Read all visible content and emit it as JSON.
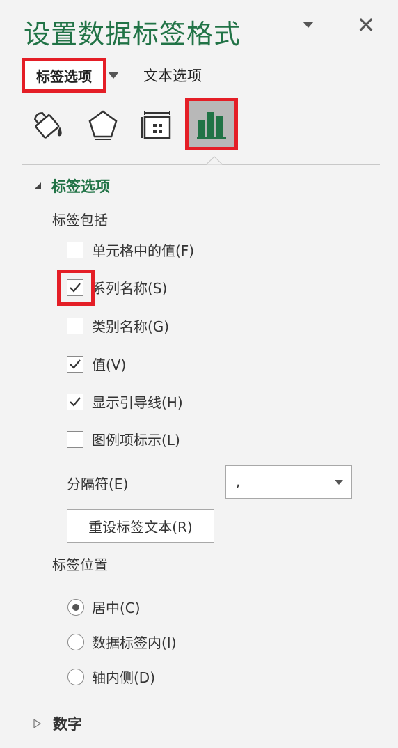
{
  "panel": {
    "title": "设置数据标签格式",
    "close_glyph": "✕"
  },
  "tabs": {
    "label_options": "标签选项",
    "text_options": "文本选项"
  },
  "icons": [
    "fill-line-icon",
    "effects-icon",
    "size-properties-icon",
    "label-options-chart-icon"
  ],
  "section": {
    "title": "标签选项",
    "label_contains": "标签包括",
    "checkboxes": [
      {
        "label": "单元格中的值(F)",
        "checked": false
      },
      {
        "label": "系列名称(S)",
        "checked": true
      },
      {
        "label": "类别名称(G)",
        "checked": false
      },
      {
        "label": "值(V)",
        "checked": true
      },
      {
        "label": "显示引导线(H)",
        "checked": true
      },
      {
        "label": "图例项标示(L)",
        "checked": false
      }
    ],
    "separator_label": "分隔符(E)",
    "separator_value": ",",
    "reset_button": "重设标签文本(R)",
    "label_position": "标签位置",
    "radios": [
      {
        "label": "居中(C)",
        "selected": true
      },
      {
        "label": "数据标签内(I)",
        "selected": false
      },
      {
        "label": "轴内侧(D)",
        "selected": false
      }
    ]
  },
  "number_section": {
    "title": "数字"
  },
  "colors": {
    "accent_green": "#217346",
    "highlight_red": "#e41e26",
    "panel_bg": "#f3f3f3"
  }
}
